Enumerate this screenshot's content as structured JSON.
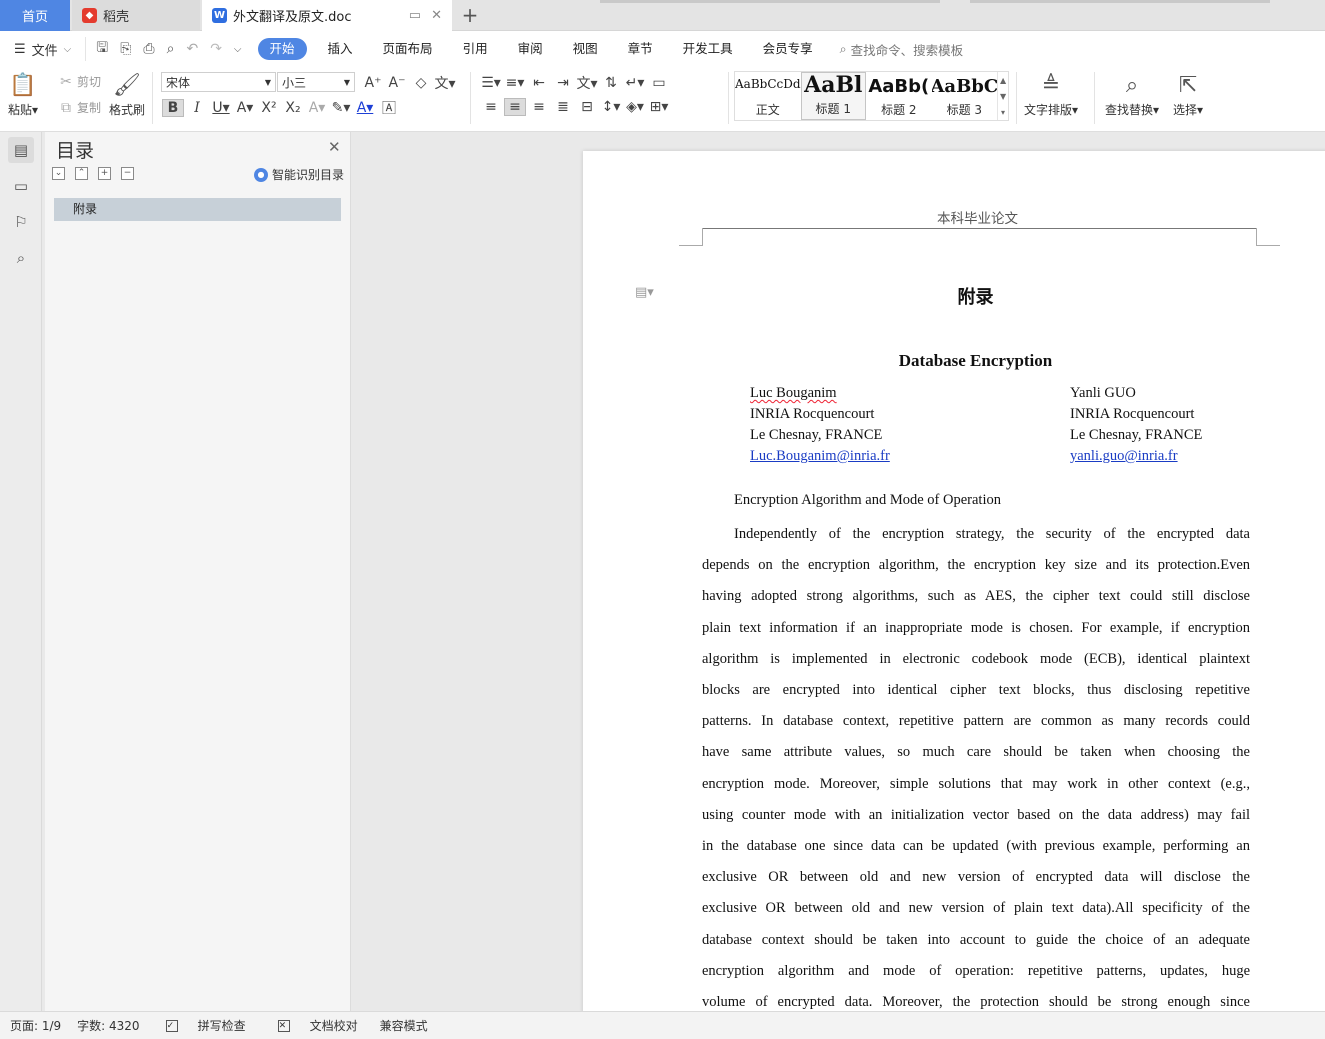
{
  "tabs": {
    "home": "首页",
    "docer": "稻壳",
    "document": "外文翻译及原文.doc"
  },
  "menu": {
    "file": "文件",
    "items": [
      "开始",
      "插入",
      "页面布局",
      "引用",
      "审阅",
      "视图",
      "章节",
      "开发工具",
      "会员专享"
    ],
    "search": "查找命令、搜索模板"
  },
  "ribbon": {
    "paste": "粘贴",
    "cut": "剪切",
    "copy": "复制",
    "format_painter": "格式刷",
    "font_name": "宋体",
    "font_size": "小三",
    "styles": [
      {
        "sample": "AaBbCcDd",
        "name": "正文"
      },
      {
        "sample": "AaBl",
        "name": "标题 1"
      },
      {
        "sample": "AaBb(",
        "name": "标题 2"
      },
      {
        "sample": "AaBbC",
        "name": "标题 3"
      }
    ],
    "text_layout": "文字排版",
    "find_replace": "查找替换",
    "select": "选择"
  },
  "toc": {
    "title": "目录",
    "smart": "智能识别目录",
    "items": [
      "附录"
    ]
  },
  "document": {
    "header": "本科毕业论文",
    "title": "附录",
    "paper_title": "Database Encryption",
    "author1": {
      "name": "Luc Bouganim",
      "org": "INRIA Rocquencourt",
      "location": "Le Chesnay, FRANCE",
      "email": "Luc.Bouganim@inria.fr"
    },
    "author2": {
      "name": "Yanli GUO",
      "org": "INRIA Rocquencourt",
      "location": "Le Chesnay, FRANCE",
      "email": "yanli.guo@inria.fr"
    },
    "section": "Encryption Algorithm and Mode of Operation",
    "lines": [
      "Independently of the encryption strategy, the security of the encrypted data",
      "depends on the encryption algorithm, the encryption key size and its protection.Even",
      "having adopted strong algorithms, such as AES, the cipher text could still disclose",
      "plain text information if an inappropriate mode is chosen. For example, if encryption",
      "algorithm is implemented in electronic codebook mode (ECB), identical plaintext",
      "blocks are encrypted into identical cipher text blocks, thus disclosing repetitive",
      "patterns. In database context, repetitive pattern are common as many records could",
      "have same attribute values, so much care should be taken when choosing the",
      "encryption mode. Moreover, simple solutions that may work in other context (e.g.,",
      "using counter mode with an initialization vector based on the data address) may fail",
      "in the database one since data can be updated (with previous example, performing an",
      "exclusive OR between old and new version of encrypted data will disclose the",
      "exclusive OR between old and new version of plain text data).All specificity of the",
      "database context should be taken into account to guide the choice of an adequate",
      "encryption algorithm and mode of operation: repetitive patterns, updates, huge",
      "volume of encrypted data. Moreover, the protection should be strong enough since"
    ]
  },
  "status": {
    "page": "页面: 1/9",
    "words": "字数: 4320",
    "spell": "拼写检查",
    "proof": "文档校对",
    "compat": "兼容模式"
  }
}
